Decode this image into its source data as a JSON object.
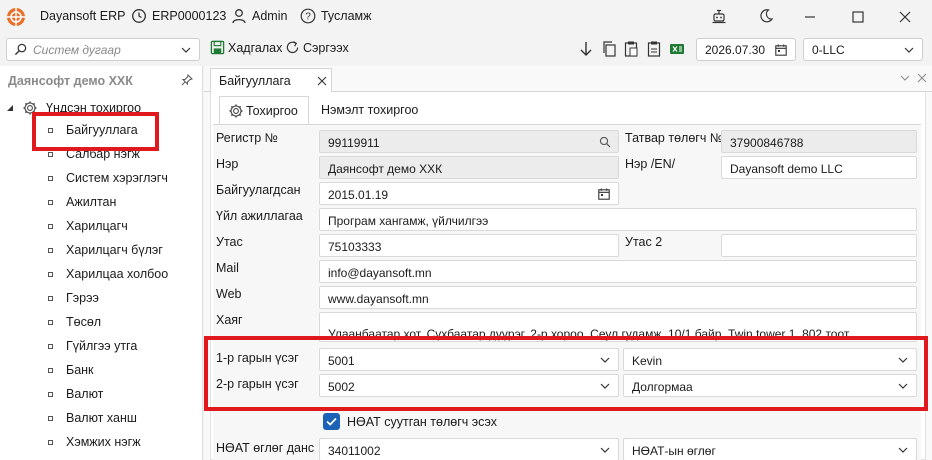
{
  "titlebar": {
    "app_name": "Dayansoft ERP",
    "document_code": "ERP0000123",
    "user": "Admin",
    "help": "Тусламж"
  },
  "toolbar": {
    "search_placeholder": "Систем дугаар",
    "save_label": "Хадгалах",
    "refresh_label": "Сэргээх",
    "date": "2026.07.30",
    "company": "0-LLC"
  },
  "sidebar": {
    "title": "Даянсофт демо ХХК",
    "root": "Үндсэн тохиргоо",
    "items": [
      "Байгууллага",
      "Салбар нэгж",
      "Систем хэрэглэгч",
      "Ажилтан",
      "Харилцагч",
      "Харилцагч бүлэг",
      "Харилцаа холбоо",
      "Гэрээ",
      "Төсөл",
      "Гүйлгээ утга",
      "Банк",
      "Валют",
      "Валют ханш",
      "Хэмжих нэгж"
    ],
    "selected": "Байгууллага"
  },
  "document_tab": {
    "label": "Байгууллага"
  },
  "sub_tabs": {
    "settings": "Тохиргоо",
    "extra": "Нэмэлт тохиргоо"
  },
  "form": {
    "register_label": "Регистр №",
    "register_value": "99119911",
    "tax_payer_label": "Татвар төлөгч №",
    "tax_payer_value": "37900846788",
    "name_label": "Нэр",
    "name_value": "Даянсофт демо ХХК",
    "name_en_label": "Нэр /EN/",
    "name_en_value": "Dayansoft demo LLC",
    "founded_label": "Байгуулагдсан",
    "founded_value": "2015.01.19",
    "activity_label": "Үйл ажиллагаа",
    "activity_value": "Програм хангамж, үйлчилгээ",
    "phone_label": "Утас",
    "phone_value": "75103333",
    "phone2_label": "Утас 2",
    "phone2_value": "",
    "mail_label": "Mail",
    "mail_value": "info@dayansoft.mn",
    "web_label": "Web",
    "web_value": "www.dayansoft.mn",
    "address_label": "Хаяг",
    "address_value": "Улаанбаатар хот, Сүхбаатар дүүрэг, 2-р хороо, Сеул гудамж, 10/1 байр, Twin tower 1, 802 тоот",
    "sign1_label": "1-р гарын үсэг",
    "sign1_code": "5001",
    "sign1_name": "Kevin",
    "sign2_label": "2-р гарын үсэг",
    "sign2_code": "5002",
    "sign2_name": "Долгормаа",
    "vat_checkbox_label": "НӨАТ суутган төлөгч эсэх",
    "vat_account_label": "НӨАТ өглөг данс",
    "vat_account_value": "34011002",
    "vat_account_name": "НӨАТ-ын өглөг"
  },
  "colors": {
    "highlight": "#e0191f",
    "accent": "#1c63b7"
  }
}
